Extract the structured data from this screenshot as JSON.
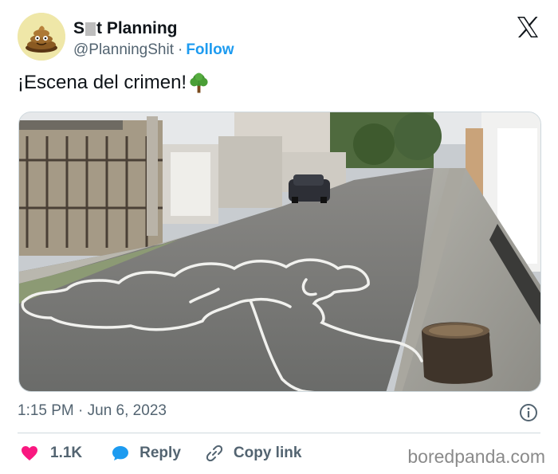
{
  "header": {
    "display_name_prefix": "S",
    "display_name_suffix": "t Planning",
    "handle": "@PlanningShit",
    "separator": "·",
    "follow_label": "Follow"
  },
  "tweet": {
    "text": "¡Escena del crimen!"
  },
  "meta": {
    "timestamp": "1:15 PM · Jun 6, 2023"
  },
  "actions": {
    "like_count": "1.1K",
    "reply_label": "Reply",
    "copy_label": "Copy link"
  },
  "watermark": "boredpanda.com",
  "colors": {
    "accent": "#1d9bf0",
    "heart": "#f91880",
    "muted": "#536471"
  },
  "icons": [
    "x-logo-icon",
    "tree-emoji-icon",
    "info-icon",
    "heart-icon",
    "speech-bubble-icon",
    "link-icon"
  ]
}
